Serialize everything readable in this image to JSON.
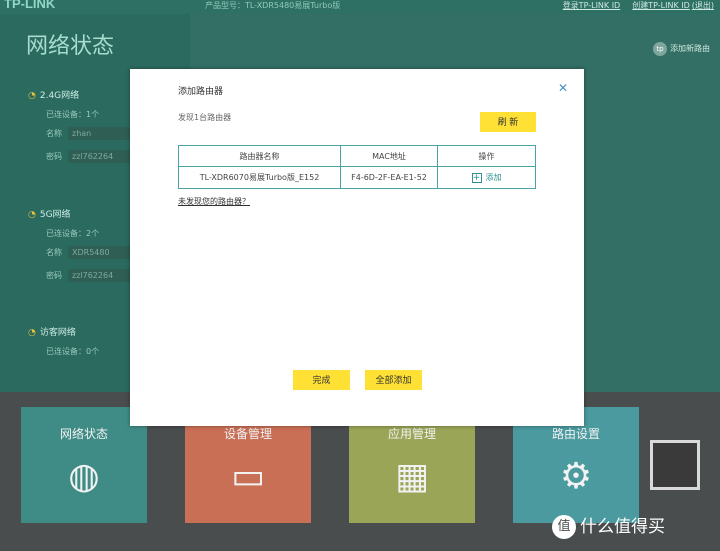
{
  "background": {
    "logo": "TP-LINK",
    "model": "产品型号：TL-XDR5480易展Turbo版",
    "top_links": {
      "login": "登录TP-LINK ID",
      "create": "创建TP-LINK ID",
      "exit": "(退出)"
    },
    "status_title": "网络状态",
    "add_router": "添加新路由",
    "wifi24": {
      "title": "2.4G网络",
      "devices": "已连设备：1个",
      "name_label": "名称",
      "name": "zhan",
      "pwd_label": "密码",
      "pwd": "zzl762264"
    },
    "wifi5": {
      "title": "5G网络",
      "devices": "已连设备：2个",
      "name_label": "名称",
      "name": "XDR5480",
      "pwd_label": "密码",
      "pwd": "zzl762264"
    },
    "guest": {
      "title": "访客网络",
      "devices": "已连设备：0个"
    },
    "tiles": {
      "status": "网络状态",
      "devices": "设备管理",
      "apps": "应用管理",
      "router": "路由设置"
    },
    "watermark": {
      "icon_text": "值",
      "text": "什么值得买"
    }
  },
  "modal": {
    "title": "添加路由器",
    "found": "发现1台路由器",
    "refresh": "刷 新",
    "columns": [
      "路由器名称",
      "MAC地址",
      "操作"
    ],
    "rows": [
      {
        "name": "TL-XDR6070易展Turbo版_E152",
        "mac": "F4-6D-2F-EA-E1-52",
        "action": "添加"
      }
    ],
    "not_found": "未发现您的路由器？",
    "finish": "完成",
    "add_all": "全部添加",
    "close_icon": "close-icon"
  }
}
